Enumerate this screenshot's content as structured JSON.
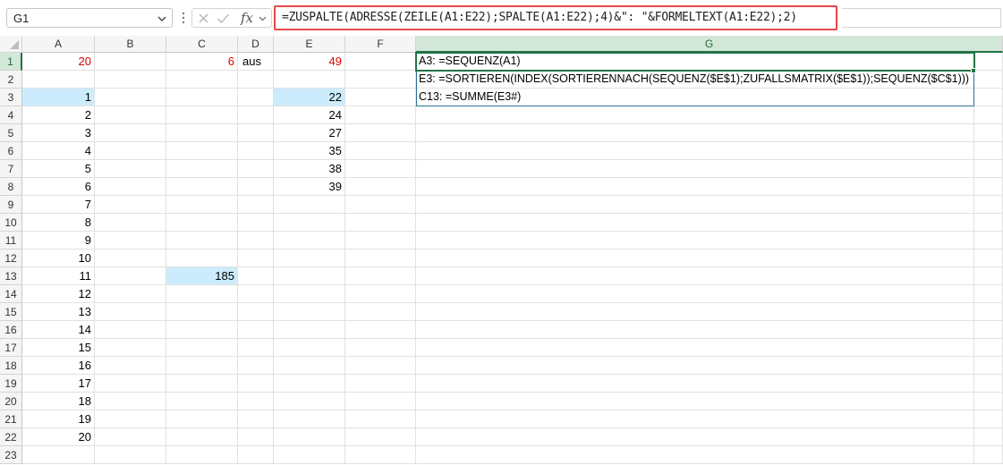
{
  "name_box": {
    "value": "G1",
    "icon": "chevron-down-icon"
  },
  "formula_bar": {
    "fx_label": "fx",
    "formula": "=ZUSPALTE(ADRESSE(ZEILE(A1:E22);SPALTE(A1:E22);4)&\": \"&FORMELTEXT(A1:E22);2)",
    "icons": [
      "cancel-icon",
      "enter-icon",
      "fx-icon",
      "chevron-down-icon"
    ],
    "highlight_color": "#e64848"
  },
  "columns": [
    "A",
    "B",
    "C",
    "D",
    "E",
    "F",
    "G"
  ],
  "selected_column": "G",
  "rows": [
    "1",
    "2",
    "3",
    "4",
    "5",
    "6",
    "7",
    "8",
    "9",
    "10",
    "11",
    "12",
    "13",
    "14",
    "15",
    "16",
    "17",
    "18",
    "19",
    "20",
    "21",
    "22",
    "23"
  ],
  "selected_row": "1",
  "cells": {
    "A1": "20",
    "C1": "6",
    "D1": "aus",
    "E1": "49",
    "A3": "1",
    "A4": "2",
    "A5": "3",
    "A6": "4",
    "A7": "5",
    "A8": "6",
    "A9": "7",
    "A10": "8",
    "A11": "9",
    "A12": "10",
    "A13": "11",
    "A14": "12",
    "A15": "13",
    "A16": "14",
    "A17": "15",
    "A18": "16",
    "A19": "17",
    "A20": "18",
    "A21": "19",
    "A22": "20",
    "E3": "22",
    "E4": "24",
    "E5": "27",
    "E6": "35",
    "E7": "38",
    "E8": "39",
    "C13": "185",
    "G1": "A3: =SEQUENZ(A1)",
    "G2": "E3: =SORTIEREN(INDEX(SORTIERENNACH(SEQUENZ($E$1);ZUFALLSMATRIX($E$1));SEQUENZ($C$1)))",
    "G3": "C13: =SUMME(E3#)"
  },
  "colors": {
    "input_red": "#e00000",
    "highlight_fill": "#ccecfd",
    "selection_green": "#217346",
    "spill_border": "#2e6e98"
  }
}
